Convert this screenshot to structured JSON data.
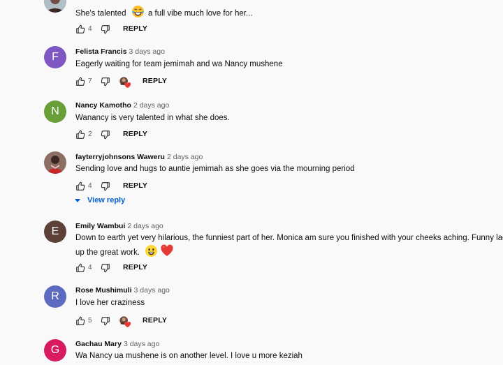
{
  "reply_label": "REPLY",
  "view_reply_label": "View reply",
  "comments": [
    {
      "author": "",
      "time": "",
      "text": "She's talented",
      "text_after": "a full vibe much love for her...",
      "likes": "4"
    },
    {
      "author": "Felista Francis",
      "time": "3 days ago",
      "text": "Eagerly waiting for team jemimah and wa Nancy mushene",
      "likes": "7",
      "avatar_letter": "F",
      "avatar_color": "#7e57c2",
      "creator_heart": true
    },
    {
      "author": "Nancy Kamotho",
      "time": "2 days ago",
      "text": "Wanancy is very talented in what she does.",
      "likes": "2",
      "avatar_letter": "N",
      "avatar_color": "#689f38"
    },
    {
      "author": "fayterryjohnsons Waweru",
      "time": "2 days ago",
      "text": "Sending  love and hugs to auntie jemimah as she goes via the mourning period",
      "likes": "4"
    },
    {
      "author": "Emily Wambui",
      "time": "2 days ago",
      "text": "Down to earth yet very hilarious, the funniest part of her. Monica am sure you finished with your cheeks aching. Funny lady,",
      "text_line2": "up the great work.",
      "likes": "4",
      "avatar_letter": "E",
      "avatar_color": "#5d4037"
    },
    {
      "author": "Rose Mushimuli",
      "time": "3 days ago",
      "text": "I love her craziness",
      "likes": "5",
      "avatar_letter": "R",
      "avatar_color": "#5c6bc0",
      "creator_heart": true
    },
    {
      "author": "Gachau Mary",
      "time": "3 days ago",
      "text": "Wa Nancy ua mushene is on another  level. I love u more keziah",
      "avatar_letter": "G",
      "avatar_color": "#d81b60"
    }
  ]
}
